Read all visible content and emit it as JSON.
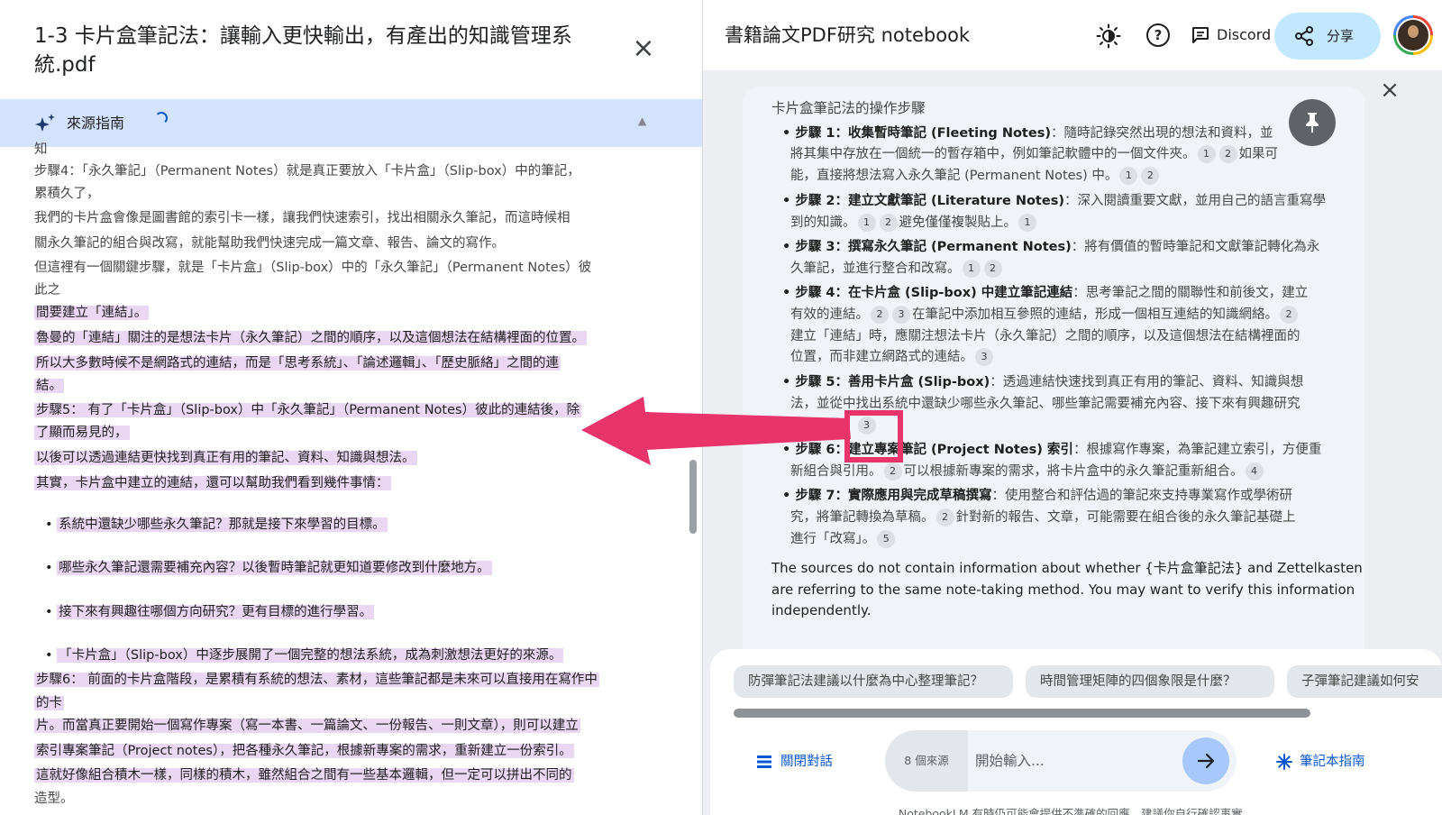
{
  "doc_panel": {
    "title_line1": "1-3 卡片盒筆記法：讓輸入更快輸出，有產出的知識管理系",
    "title_line2": "統.pdf",
    "close_icon": "close-icon",
    "guide_label": "來源指南",
    "guide_icon": "sparkle-icon",
    "lines": [
      {
        "text": "知",
        "hl": false
      },
      {
        "text": "步驟4：「永久筆記」（Permanent Notes）就是真正要放入「卡片盒」（Slip-box）中的筆記，",
        "hl": false
      },
      {
        "text": "累積久了，",
        "hl": false
      },
      {
        "text": "我們的卡片盒會像是圖書館的索引卡一樣，讓我們快速索引，找出相關永久筆記，而這時候相",
        "hl": false
      },
      {
        "text": "關永久筆記的組合與改寫，就能幫助我們快速完成一篇文章、報告、論文的寫作。",
        "hl": false
      },
      {
        "text": "但這裡有一個關鍵步驟，就是「卡片盒」（Slip-box）中的「永久筆記」（Permanent Notes）彼",
        "hl": false
      },
      {
        "text": "此之",
        "hl": false
      },
      {
        "text": "間要建立「連結」。",
        "hl": true
      },
      {
        "text": "魯曼的「連結」關注的是想法卡片（永久筆記）之間的順序，以及這個想法在結構裡面的位置。",
        "hl": true
      },
      {
        "text": "所以大多數時候不是網路式的連結，而是「思考系統」、「論述邏輯」、「歷史脈絡」之間的連",
        "hl": true
      },
      {
        "text": "結。",
        "hl": true
      },
      {
        "text": "步驟5： 有了「卡片盒」（Slip-box）中「永久筆記」（Permanent Notes）彼此的連結後，除",
        "hl": true
      },
      {
        "text": "了顯而易見的，",
        "hl": true
      },
      {
        "text": "以後可以透過連結更快找到真正有用的筆記、資料、知識與想法。",
        "hl": true
      },
      {
        "text": "其實，卡片盒中建立的連結，還可以幫助我們看到幾件事情：",
        "hl": true
      },
      {
        "text": "系統中還缺少哪些永久筆記？那就是接下來學習的目標。",
        "hl": true,
        "bullet": true
      },
      {
        "text": "哪些永久筆記還需要補充內容？以後暫時筆記就更知道要修改到什麼地方。",
        "hl": true,
        "bullet": true
      },
      {
        "text": "接下來有興趣往哪個方向研究？更有目標的進行學習。",
        "hl": true,
        "bullet": true
      },
      {
        "text": "「卡片盒」（Slip-box）中逐步展開了一個完整的想法系統，成為刺激想法更好的來源。",
        "hl": true,
        "bullet": true
      },
      {
        "text": "步驟6： 前面的卡片盒階段，是累積有系統的想法、素材，這些筆記都是未來可以直接用在寫作中",
        "hl": true
      },
      {
        "text": "的卡",
        "hl": true
      },
      {
        "text": "片。而當真正要開始一個寫作專案（寫一本書、一篇論文、一份報告、一則文章），則可以建立",
        "hl": true
      },
      {
        "text": "索引專案筆記（Project notes），把各種永久筆記，根據新專案的需求，重新建立一份索引。",
        "hl": true
      },
      {
        "text": "這就好像組合積木一樣，同樣的積木，雖然組合之間有一些基本邏輯，但一定可以拼出不同的",
        "hl": true
      },
      {
        "text": "造型。",
        "hl": false
      }
    ]
  },
  "notebook": {
    "title": "書籍論文PDF研究 notebook",
    "theme_icon": "brightness-icon",
    "help_icon": "help-icon",
    "help_glyph": "?",
    "discord_label": "Discord",
    "share_label": "分享",
    "avatar_icon": "avatar",
    "card": {
      "heading": "卡片盒筆記法的操作步驟",
      "pin_icon": "pin-icon",
      "steps": [
        {
          "bold": "步驟 1：收集暫時筆記 (Fleeting Notes)",
          "l1": "：隨時記錄突然出現的想法和資料，並",
          "l2": "將其集中存放在一個統一的暫存箱中，例如筆記軟體中的一個文件夾。",
          "c2": [
            "1",
            "2"
          ],
          "l2b": "如果可",
          "l3": "能，直接將想法寫入永久筆記 (Permanent Notes) 中。",
          "c3": [
            "1",
            "2"
          ]
        },
        {
          "bold": "步驟 2：建立文獻筆記 (Literature Notes)",
          "l1": "：深入閱讀重要文獻，並用自己的語言重寫學",
          "l2": "到的知識。",
          "c2": [
            "1",
            "2"
          ],
          "l2b": "避免僅僅複製貼上。",
          "c2b": [
            "1"
          ]
        },
        {
          "bold": "步驟 3：撰寫永久筆記 (Permanent Notes)",
          "l1": "：將有價值的暫時筆記和文獻筆記轉化為永",
          "l2": "久筆記，並進行整合和改寫。",
          "c2": [
            "1",
            "2"
          ]
        },
        {
          "bold": "步驟 4：在卡片盒 (Slip-box) 中建立筆記連結",
          "l1": "：思考筆記之間的關聯性和前後文，建立",
          "l2": "有效的連結。",
          "c2": [
            "2",
            "3"
          ],
          "l2b": "在筆記中添加相互參照的連結，形成一個相互連結的知識網絡。",
          "c2b": [
            "2"
          ],
          "l3": "建立「連結」時，應關注想法卡片（永久筆記）之間的順序，以及這個想法在結構裡面的",
          "l4": "位置，而非建立網路式的連結。",
          "c4": [
            "3"
          ]
        },
        {
          "bold": "步驟 5：善用卡片盒 (Slip-box)",
          "l1": "：透過連結快速找到真正有用的筆記、資料、知識與想",
          "l2": "法，並從中找出系統中還缺少哪些永久筆記、哪些筆記需要補充內容、接下來有興趣研究",
          "l3": "的方向等。",
          "c3": [
            "3"
          ]
        },
        {
          "bold": "步驟 6：建立專案筆記 (Project Notes) 索引",
          "l1": "：根據寫作專案，為筆記建立索引，方便重",
          "l2": "新組合與引用。",
          "c2": [
            "2"
          ],
          "l2b": "可以根據新專案的需求，將卡片盒中的永久筆記重新組合。",
          "c2b": [
            "4"
          ]
        },
        {
          "bold": "步驟 7：實際應用與完成草稿撰寫",
          "l1": "：使用整合和評估過的筆記來支持專業寫作或學術研",
          "l2": "究，將筆記轉換為草稿。",
          "c2": [
            "2"
          ],
          "l2b": "針對新的報告、文章，可能需要在組合後的永久筆記基礎上",
          "l3": "進行「改寫」。",
          "c3": [
            "5"
          ]
        }
      ],
      "footer_l1": "The sources do not contain information about whether {卡片盒筆記法} and Zettelkasten",
      "footer_l2": "are referring to the same note-taking method. You may want to verify this information",
      "footer_l3": "independently."
    },
    "suggestions": [
      "防彈筆記法建議以什麼為中心整理筆記？",
      "時間管理矩陣的四個象限是什麼？",
      "子彈筆記建議如何安"
    ],
    "close_chat_label": "關閉對話",
    "source_count": "8 個來源",
    "input_placeholder": "開始輸入...",
    "send_icon": "arrow-right-icon",
    "notebook_guide_label": "筆記本指南",
    "disclaimer": "NotebookLM 有時仍可能會提供不準確的回應，建議你自行確認事實。"
  },
  "colors": {
    "highlight": "#ead7f4",
    "guide_bar": "#d3e3fd",
    "share_button": "#c2e7ff",
    "accent": "#0b57d0",
    "annotation": "#e8336b"
  }
}
